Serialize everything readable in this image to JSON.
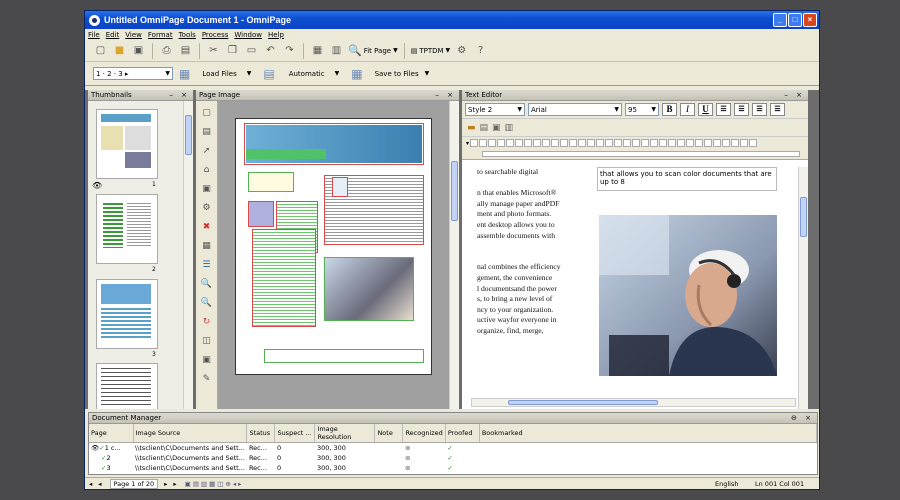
{
  "window": {
    "title": "Untitled OmniPage Document 1 - OmniPage"
  },
  "menu": [
    "File",
    "Edit",
    "View",
    "Format",
    "Tools",
    "Process",
    "Window",
    "Help"
  ],
  "toolbar": {
    "fit_page_label": "Fit Page",
    "ocr_lang_label": "TPTDM",
    "step_label": "1 · 2 · 3 ▸",
    "load_files_label": "Load Files",
    "automatic_label": "Automatic",
    "save_files_label": "Save to Files"
  },
  "panes": {
    "thumbnails": {
      "title": "Thumbnails",
      "pages": [
        "1",
        "2",
        "3"
      ]
    },
    "page_image": {
      "title": "Page Image"
    },
    "text_editor": {
      "title": "Text Editor",
      "style": "Style 2",
      "font": "Arial",
      "size": "95",
      "bold": "B",
      "italic": "I",
      "underline": "U",
      "column1_lines": [
        "to searchable digital",
        "",
        "n that enables Microsoft®",
        "ally manage paper andPDF",
        "ment and photo formats.",
        "ent desktop allows you to",
        "assemble documents with",
        "",
        "",
        "nal combines the efficiency",
        "gement, the convenience",
        "l documentsand the power",
        "s, to bring a new level of",
        "ncy to your organization.",
        "uctive wayfor everyone in",
        " organize, find, merge,"
      ],
      "column2_text": "that allows you to scan color documents that are up to 8"
    }
  },
  "doc_manager": {
    "title": "Document Manager",
    "columns": [
      "Page",
      "Image Source",
      "Status",
      "Suspect ...",
      "Image Resolution",
      "Note",
      "Recognized",
      "Proofed",
      "Bookmarked"
    ],
    "rows": [
      {
        "page": "1 c...",
        "source": "\\\\tsclient\\C\\Documents and Sett...",
        "status": "Rec...",
        "suspect": "0",
        "res": "300, 300"
      },
      {
        "page": "2",
        "source": "\\\\tsclient\\C\\Documents and Sett...",
        "status": "Rec...",
        "suspect": "0",
        "res": "300, 300"
      },
      {
        "page": "3",
        "source": "\\\\tsclient\\C\\Documents and Sett...",
        "status": "Rec...",
        "suspect": "0",
        "res": "300, 300"
      }
    ]
  },
  "status": {
    "page": "Page 1 of 20",
    "language": "English",
    "position": "Ln 001  Col 001"
  },
  "colors": {
    "title_blue": "#0d4fd2",
    "pane_bg": "#6d6d6d",
    "zone_red": "#d64b4b",
    "zone_green": "#53b053"
  }
}
